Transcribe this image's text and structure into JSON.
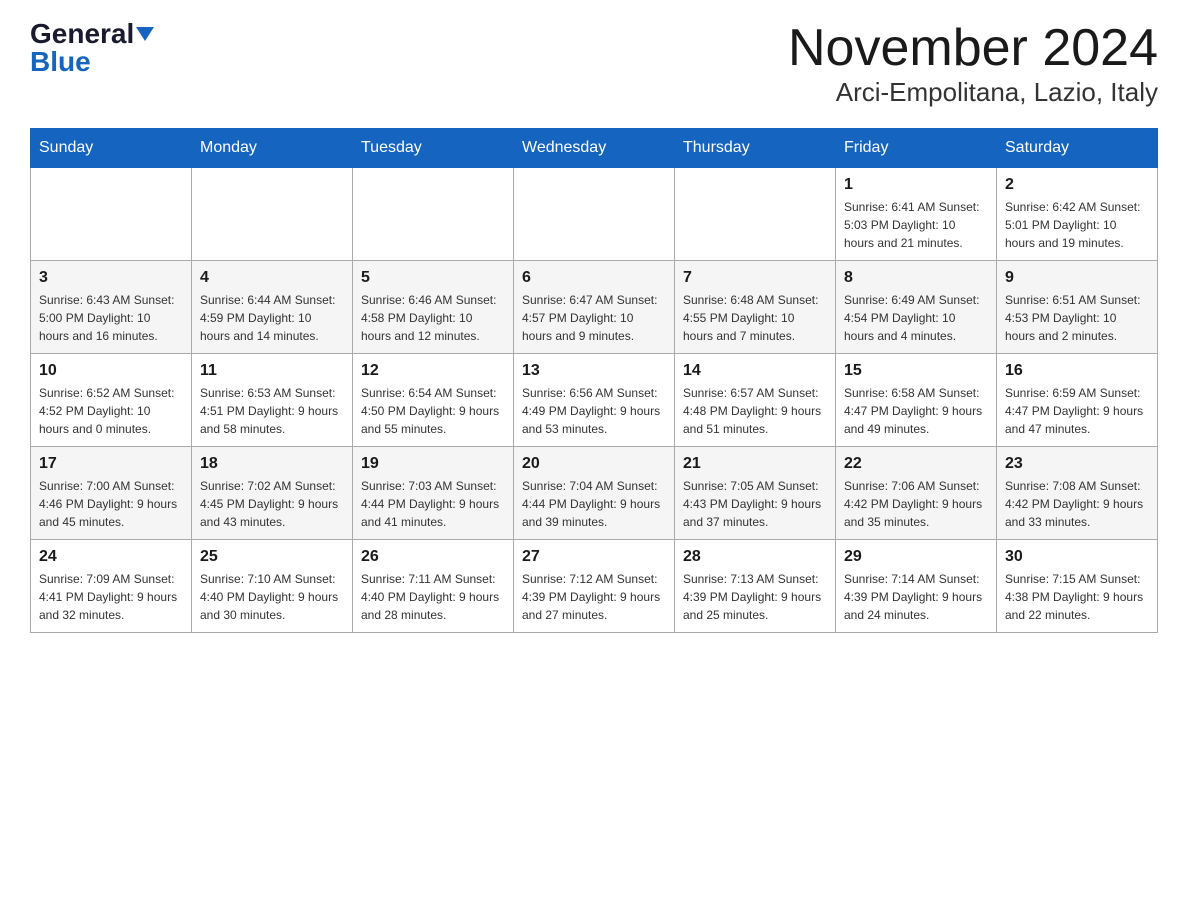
{
  "header": {
    "logo": {
      "general_text": "General",
      "blue_text": "Blue"
    },
    "title": "November 2024",
    "location": "Arci-Empolitana, Lazio, Italy"
  },
  "days_of_week": [
    "Sunday",
    "Monday",
    "Tuesday",
    "Wednesday",
    "Thursday",
    "Friday",
    "Saturday"
  ],
  "weeks": [
    {
      "days": [
        {
          "number": "",
          "info": ""
        },
        {
          "number": "",
          "info": ""
        },
        {
          "number": "",
          "info": ""
        },
        {
          "number": "",
          "info": ""
        },
        {
          "number": "",
          "info": ""
        },
        {
          "number": "1",
          "info": "Sunrise: 6:41 AM\nSunset: 5:03 PM\nDaylight: 10 hours\nand 21 minutes."
        },
        {
          "number": "2",
          "info": "Sunrise: 6:42 AM\nSunset: 5:01 PM\nDaylight: 10 hours\nand 19 minutes."
        }
      ]
    },
    {
      "days": [
        {
          "number": "3",
          "info": "Sunrise: 6:43 AM\nSunset: 5:00 PM\nDaylight: 10 hours\nand 16 minutes."
        },
        {
          "number": "4",
          "info": "Sunrise: 6:44 AM\nSunset: 4:59 PM\nDaylight: 10 hours\nand 14 minutes."
        },
        {
          "number": "5",
          "info": "Sunrise: 6:46 AM\nSunset: 4:58 PM\nDaylight: 10 hours\nand 12 minutes."
        },
        {
          "number": "6",
          "info": "Sunrise: 6:47 AM\nSunset: 4:57 PM\nDaylight: 10 hours\nand 9 minutes."
        },
        {
          "number": "7",
          "info": "Sunrise: 6:48 AM\nSunset: 4:55 PM\nDaylight: 10 hours\nand 7 minutes."
        },
        {
          "number": "8",
          "info": "Sunrise: 6:49 AM\nSunset: 4:54 PM\nDaylight: 10 hours\nand 4 minutes."
        },
        {
          "number": "9",
          "info": "Sunrise: 6:51 AM\nSunset: 4:53 PM\nDaylight: 10 hours\nand 2 minutes."
        }
      ]
    },
    {
      "days": [
        {
          "number": "10",
          "info": "Sunrise: 6:52 AM\nSunset: 4:52 PM\nDaylight: 10 hours\nand 0 minutes."
        },
        {
          "number": "11",
          "info": "Sunrise: 6:53 AM\nSunset: 4:51 PM\nDaylight: 9 hours\nand 58 minutes."
        },
        {
          "number": "12",
          "info": "Sunrise: 6:54 AM\nSunset: 4:50 PM\nDaylight: 9 hours\nand 55 minutes."
        },
        {
          "number": "13",
          "info": "Sunrise: 6:56 AM\nSunset: 4:49 PM\nDaylight: 9 hours\nand 53 minutes."
        },
        {
          "number": "14",
          "info": "Sunrise: 6:57 AM\nSunset: 4:48 PM\nDaylight: 9 hours\nand 51 minutes."
        },
        {
          "number": "15",
          "info": "Sunrise: 6:58 AM\nSunset: 4:47 PM\nDaylight: 9 hours\nand 49 minutes."
        },
        {
          "number": "16",
          "info": "Sunrise: 6:59 AM\nSunset: 4:47 PM\nDaylight: 9 hours\nand 47 minutes."
        }
      ]
    },
    {
      "days": [
        {
          "number": "17",
          "info": "Sunrise: 7:00 AM\nSunset: 4:46 PM\nDaylight: 9 hours\nand 45 minutes."
        },
        {
          "number": "18",
          "info": "Sunrise: 7:02 AM\nSunset: 4:45 PM\nDaylight: 9 hours\nand 43 minutes."
        },
        {
          "number": "19",
          "info": "Sunrise: 7:03 AM\nSunset: 4:44 PM\nDaylight: 9 hours\nand 41 minutes."
        },
        {
          "number": "20",
          "info": "Sunrise: 7:04 AM\nSunset: 4:44 PM\nDaylight: 9 hours\nand 39 minutes."
        },
        {
          "number": "21",
          "info": "Sunrise: 7:05 AM\nSunset: 4:43 PM\nDaylight: 9 hours\nand 37 minutes."
        },
        {
          "number": "22",
          "info": "Sunrise: 7:06 AM\nSunset: 4:42 PM\nDaylight: 9 hours\nand 35 minutes."
        },
        {
          "number": "23",
          "info": "Sunrise: 7:08 AM\nSunset: 4:42 PM\nDaylight: 9 hours\nand 33 minutes."
        }
      ]
    },
    {
      "days": [
        {
          "number": "24",
          "info": "Sunrise: 7:09 AM\nSunset: 4:41 PM\nDaylight: 9 hours\nand 32 minutes."
        },
        {
          "number": "25",
          "info": "Sunrise: 7:10 AM\nSunset: 4:40 PM\nDaylight: 9 hours\nand 30 minutes."
        },
        {
          "number": "26",
          "info": "Sunrise: 7:11 AM\nSunset: 4:40 PM\nDaylight: 9 hours\nand 28 minutes."
        },
        {
          "number": "27",
          "info": "Sunrise: 7:12 AM\nSunset: 4:39 PM\nDaylight: 9 hours\nand 27 minutes."
        },
        {
          "number": "28",
          "info": "Sunrise: 7:13 AM\nSunset: 4:39 PM\nDaylight: 9 hours\nand 25 minutes."
        },
        {
          "number": "29",
          "info": "Sunrise: 7:14 AM\nSunset: 4:39 PM\nDaylight: 9 hours\nand 24 minutes."
        },
        {
          "number": "30",
          "info": "Sunrise: 7:15 AM\nSunset: 4:38 PM\nDaylight: 9 hours\nand 22 minutes."
        }
      ]
    }
  ]
}
